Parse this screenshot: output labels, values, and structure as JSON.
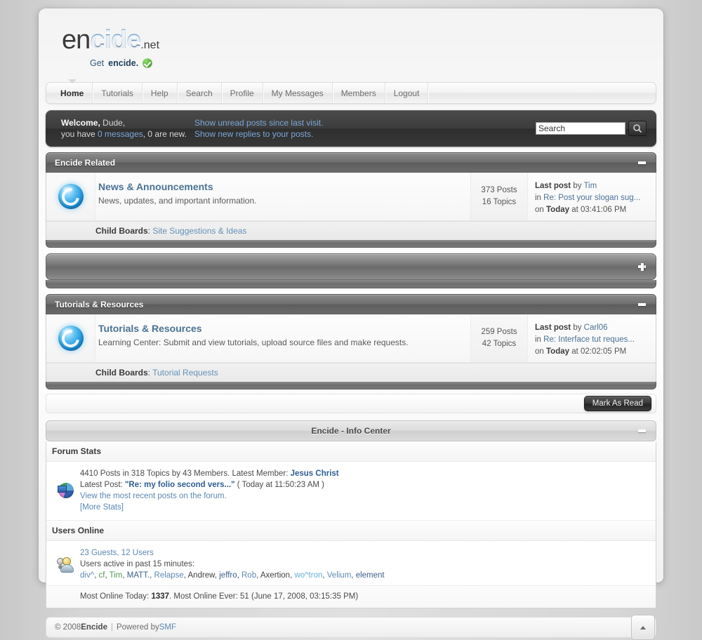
{
  "site": {
    "logo_part1": "en",
    "logo_part2": "cide",
    "logo_suffix": ".net",
    "tagline_prefix": "Get ",
    "tagline_bold": "encide.",
    "check_icon": "check-badge-icon"
  },
  "nav": {
    "items": [
      {
        "label": "Home",
        "active": true
      },
      {
        "label": "Tutorials",
        "active": false
      },
      {
        "label": "Help",
        "active": false
      },
      {
        "label": "Search",
        "active": false
      },
      {
        "label": "Profile",
        "active": false
      },
      {
        "label": "My Messages",
        "active": false
      },
      {
        "label": "Members",
        "active": false
      },
      {
        "label": "Logout",
        "active": false
      }
    ]
  },
  "welcome": {
    "greeting_bold": "Welcome,",
    "username": " Dude,",
    "line2_prefix": "you have ",
    "messages_link": "0 messages",
    "line2_suffix": ", 0 are new.",
    "link_unread": "Show unread posts since last visit.",
    "link_replies": "Show new replies to your posts."
  },
  "search": {
    "value": "Search",
    "placeholder": "Search",
    "button_icon": "magnifier-icon"
  },
  "categories": [
    {
      "title": "Encide Related",
      "collapsed": false,
      "collapse_icon": "minus-icon",
      "boards": [
        {
          "icon": "board-swirl-icon",
          "name": "News & Announcements",
          "description": "News, updates, and important information.",
          "posts": "373 Posts",
          "topics": "16 Topics",
          "lastpost_label": "Last post",
          "lastpost_by": " by ",
          "lastpost_author": "Tim",
          "lastpost_in": "in ",
          "lastpost_topic": "Re: Post your slogan sug...",
          "lastpost_on": "on ",
          "lastpost_day": "Today",
          "lastpost_at": " at 03:41:06 PM",
          "child_label": "Child Boards",
          "child_boards": [
            "Site Suggestions & Ideas"
          ]
        }
      ]
    }
  ],
  "collapsed_category": {
    "title": "",
    "collapse_icon": "plus-icon"
  },
  "categories2": [
    {
      "title": "Tutorials & Resources",
      "collapsed": false,
      "collapse_icon": "minus-icon",
      "boards": [
        {
          "icon": "board-swirl-icon",
          "name": "Tutorials & Resources",
          "description": "Learning Center: Submit and view tutorials, upload source files and make requests.",
          "posts": "259 Posts",
          "topics": "42 Topics",
          "lastpost_label": "Last post",
          "lastpost_by": " by ",
          "lastpost_author": "Carl06",
          "lastpost_in": "in ",
          "lastpost_topic": "Re: Interface tut reques...",
          "lastpost_on": "on ",
          "lastpost_day": "Today",
          "lastpost_at": " at 02:02:05 PM",
          "child_label": "Child Boards",
          "child_boards": [
            "Tutorial Requests"
          ]
        }
      ]
    }
  ],
  "toolbar": {
    "mark_as_read_label": "Mark As Read"
  },
  "info_center": {
    "title": "Encide - Info Center",
    "collapse_icon": "minus-icon",
    "forum_stats": {
      "section_title": "Forum Stats",
      "icon": "pie-chart-icon",
      "summary": "4410 Posts in 318 Topics by 43 Members. Latest Member: ",
      "latest_member": "Jesus Christ",
      "latest_post_label": "Latest Post: ",
      "latest_post_title": "\"Re: my folio second vers...\"",
      "latest_post_time": " ( Today at 11:50:23 AM )",
      "view_recent_link": "View the most recent posts on the forum.",
      "more_stats_link": "[More Stats]"
    },
    "users_online": {
      "section_title": "Users Online",
      "icon": "users-group-icon",
      "guests_users": "23 Guests, 12 Users",
      "active_label": "Users active in past 15 minutes:",
      "users": [
        {
          "name": "div^",
          "color": "#5b88b5"
        },
        {
          "name": "cf",
          "color": "#4f9a53"
        },
        {
          "name": "Tim",
          "color": "#4f9a53"
        },
        {
          "name": "MATT.",
          "color": "#3a5f87"
        },
        {
          "name": "Relapse",
          "color": "#5b88b5"
        },
        {
          "name": "Andrew",
          "color": "#3f3f3f"
        },
        {
          "name": "jeffro",
          "color": "#3a5f87"
        },
        {
          "name": "Rob",
          "color": "#5b88b5"
        },
        {
          "name": "Axertion",
          "color": "#3f3f3f"
        },
        {
          "name": "wo^tron",
          "color": "#62b0d6"
        },
        {
          "name": "Velium",
          "color": "#5b88b5"
        },
        {
          "name": "element",
          "color": "#3a5f87"
        }
      ],
      "most_online_today_label": "Most Online Today: ",
      "most_online_today": "1337",
      "most_online_ever_label": ". Most Online Ever: 51 (June 17, 2008, 03:15:35 PM)"
    }
  },
  "footer": {
    "copyright": "© 2008 ",
    "site_name": "Encide",
    "separator": "|",
    "powered_by_prefix": "Powered by ",
    "powered_by_link": "SMF",
    "top_button_icon": "arrow-up-icon"
  }
}
